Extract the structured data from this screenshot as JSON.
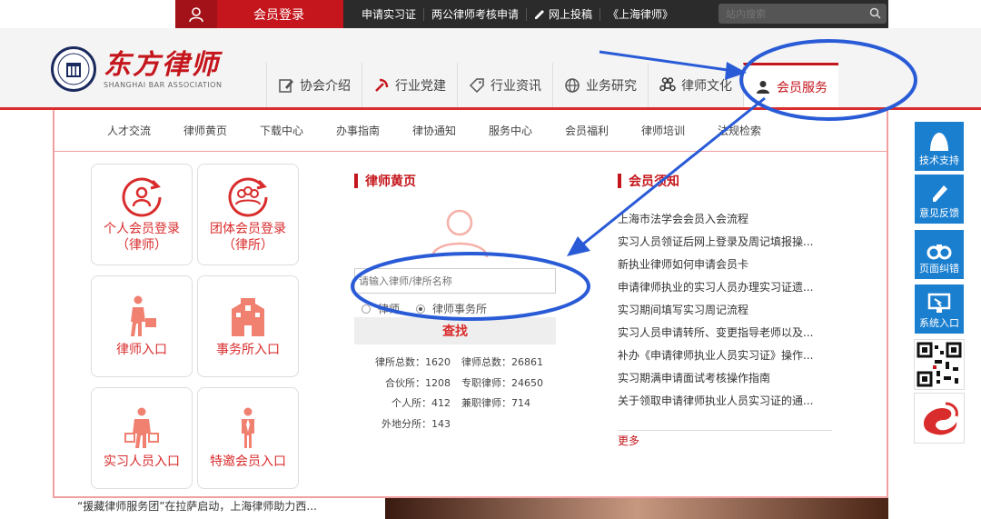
{
  "topbar": {
    "login_label": "会员登录",
    "links": [
      "申请实习证",
      "两公律师考核申请",
      "网上投稿",
      "《上海律师》"
    ],
    "search_placeholder": "站内搜索"
  },
  "header": {
    "logo_cn": "东方律师",
    "logo_en": "SHANGHAI BAR ASSOCIATION",
    "nav": [
      {
        "label": "协会介绍",
        "icon": "edit-icon"
      },
      {
        "label": "行业党建",
        "icon": "party-icon"
      },
      {
        "label": "行业资讯",
        "icon": "tag-icon"
      },
      {
        "label": "业务研究",
        "icon": "globe-icon"
      },
      {
        "label": "律师文化",
        "icon": "command-icon"
      },
      {
        "label": "会员服务",
        "icon": "user-icon"
      }
    ]
  },
  "subnav": [
    "人才交流",
    "律师黄页",
    "下载中心",
    "办事指南",
    "律协通知",
    "服务中心",
    "会员福利",
    "律师培训",
    "法规检索"
  ],
  "tiles": [
    {
      "label": "个人会员登录\n（律师）",
      "icon": "person-login-icon"
    },
    {
      "label": "团体会员登录\n（律所）",
      "icon": "group-login-icon"
    },
    {
      "label": "律师入口",
      "icon": "lawyer-icon"
    },
    {
      "label": "事务所入口",
      "icon": "building-icon"
    },
    {
      "label": "实习人员入口",
      "icon": "intern-icon"
    },
    {
      "label": "特邀会员入口",
      "icon": "special-member-icon"
    }
  ],
  "yellow_pages": {
    "title": "律师黄页",
    "input_placeholder": "请输入律师/律所名称",
    "radio_options": [
      "律师",
      "律师事务所"
    ],
    "selected": "律师事务所",
    "find_label": "查找",
    "stats": [
      [
        "律所总数：1620",
        "律师总数：26861"
      ],
      [
        "合伙所：1208",
        "专职律师：24650"
      ],
      [
        "个人所：412",
        "兼职律师：714"
      ],
      [
        "外地分所：143",
        ""
      ]
    ]
  },
  "notices": {
    "title": "会员须知",
    "items": [
      "上海市法学会会员入会流程",
      "实习人员领证后网上登录及周记填报操...",
      "新执业律师如何申请会员卡",
      "申请律师执业的实习人员办理实习证遗...",
      "实习期间填写实习周记流程",
      "实习人员申请转所、变更指导老师以及...",
      "补办《申请律师执业人员实习证》操作...",
      "实习期满申请面试考核操作指南",
      "关于领取申请律师执业人员实习证的通..."
    ],
    "more": "更多"
  },
  "sidebar": [
    "技术支持",
    "意见反馈",
    "页面纠错",
    "系统入口"
  ],
  "bottom_news": "“援藏律师服务团”在拉萨启动，上海律师助力西...",
  "colors": {
    "brand_red": "#c4161c",
    "annotation_blue": "#2a5bd7",
    "side_blue": "#1b7fcf"
  }
}
